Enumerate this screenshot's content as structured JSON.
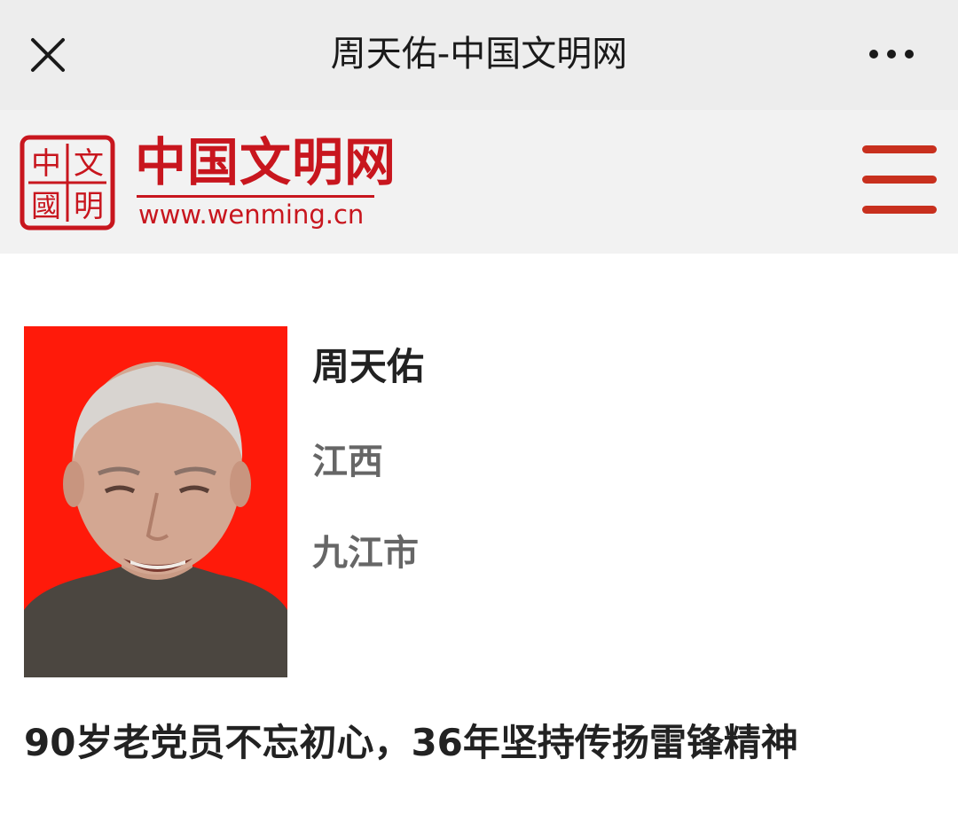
{
  "topbar": {
    "title": "周天佑-中国文明网",
    "close_icon": "close-icon",
    "more_icon": "more-horizontal-icon"
  },
  "site": {
    "brand_name": "中国文明网",
    "brand_url": "www.wenming.cn",
    "seal_chars": [
      "中",
      "文",
      "國",
      "明"
    ],
    "menu_icon": "hamburger-menu-icon",
    "brand_color": "#c8161e"
  },
  "profile": {
    "name": "周天佑",
    "province": "江西",
    "city": "九江市",
    "photo_background": "#ff1a0a"
  },
  "article": {
    "headline": "90岁老党员不忘初心，36年坚持传扬雷锋精神"
  }
}
